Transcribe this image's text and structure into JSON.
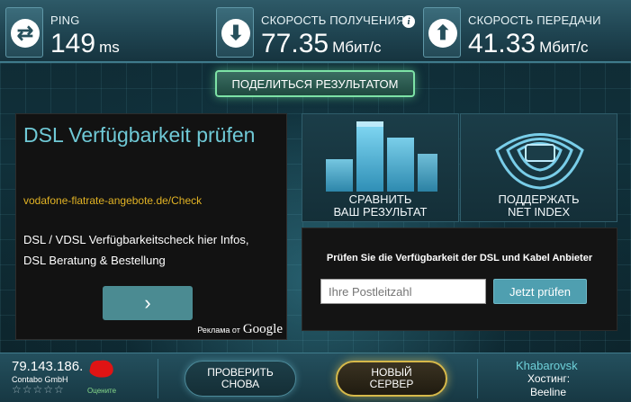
{
  "stats": {
    "ping": {
      "icon": "swap-arrows-icon",
      "label": "PING",
      "value": "149",
      "unit": "ms"
    },
    "download": {
      "icon": "download-arrow-icon",
      "label": "СКОРОСТЬ ПОЛУЧЕНИЯ",
      "value": "77.35",
      "unit": "Мбит/с"
    },
    "upload": {
      "icon": "upload-arrow-icon",
      "label": "СКОРОСТЬ ПЕРЕДАЧИ",
      "value": "41.33",
      "unit": "Мбит/с"
    }
  },
  "share_label": "ПОДЕЛИТЬСЯ РЕЗУЛЬТАТОМ",
  "ad": {
    "title": "DSL Verfügbarkeit prüfen",
    "link": "vodafone-flatrate-angebote.de/Check",
    "desc_line1": "DSL / VDSL Verfügbarkeitscheck hier Infos,",
    "desc_line2": "DSL Beratung & Bestellung",
    "arrow": "›",
    "attribution": "Реклама от",
    "attribution_brand": "Google"
  },
  "tiles": {
    "compare_line1": "СРАВНИТЬ",
    "compare_line2": "ВАШ РЕЗУЛЬТАТ",
    "support_line1": "ПОДДЕРЖАТЬ",
    "support_line2": "NET INDEX"
  },
  "availability": {
    "text": "Prüfen Sie die Verfügbarkeit der DSL und Kabel Anbieter",
    "zip_placeholder": "Ihre Postleitzahl",
    "button": "Jetzt prüfen"
  },
  "bottom": {
    "ip": "79.143.186.",
    "isp": "Contabo GmbH",
    "stars": "☆☆☆☆☆",
    "rate_label": "Оцените",
    "retest_line1": "ПРОВЕРИТЬ",
    "retest_line2": "СНОВА",
    "newserver_line1": "НОВЫЙ",
    "newserver_line2": "СЕРВЕР",
    "server_city": "Khabarovsk",
    "host_label": "Хостинг:",
    "host": "Beeline"
  },
  "colors": {
    "accent": "#6fc9d6",
    "share_border": "#7de2a6",
    "new_server_border": "#d6b94a",
    "ad_link": "#e2b324"
  }
}
